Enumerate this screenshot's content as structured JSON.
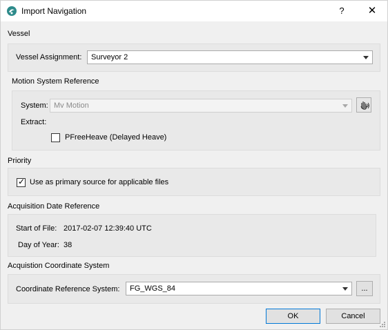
{
  "window": {
    "title": "Import Navigation",
    "help_label": "?",
    "close_label": "✕"
  },
  "vessel": {
    "section_title": "Vessel",
    "assignment_label": "Vessel Assignment:",
    "assignment_value": "Surveyor 2"
  },
  "motion": {
    "section_title": "Motion System Reference",
    "system_label": "System:",
    "system_value": "Mv Motion",
    "extract_label": "Extract:",
    "pfreeheave_label": "PFreeHeave (Delayed Heave)",
    "pfreeheave_checked": false
  },
  "priority": {
    "section_title": "Priority",
    "primary_label": "Use as primary source for applicable files",
    "primary_checked": true
  },
  "acquisition_date": {
    "section_title": "Acquisition Date Reference",
    "start_label": "Start of File:",
    "start_value": "2017-02-07 12:39:40 UTC",
    "doy_label": "Day of Year:",
    "doy_value": "38"
  },
  "coordinate_system": {
    "section_title": "Acquistion Coordinate System",
    "crs_label": "Coordinate Reference System:",
    "crs_value": "FG_WGS_84",
    "browse_label": "..."
  },
  "buttons": {
    "ok_label": "OK",
    "cancel_label": "Cancel"
  },
  "colors": {
    "accent": "#0078d7",
    "app_icon": "#2e8b8b"
  }
}
